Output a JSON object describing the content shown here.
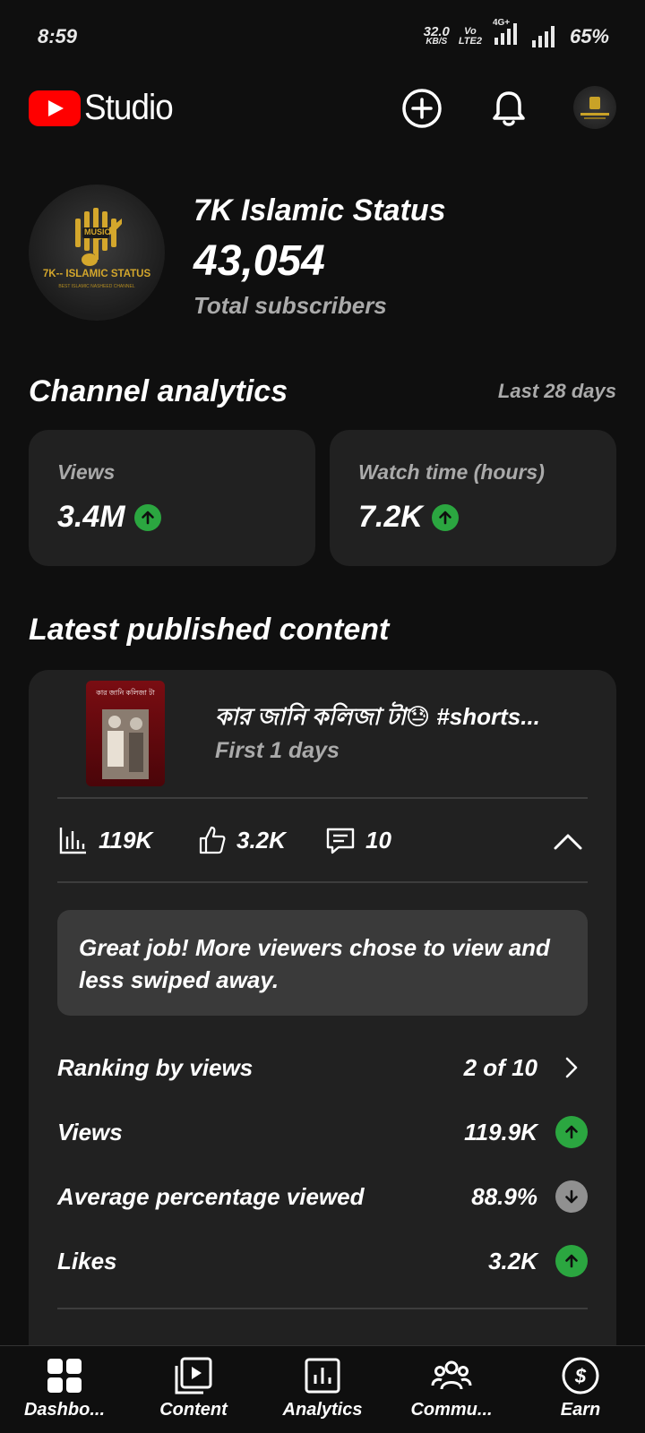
{
  "status_bar": {
    "time": "8:59",
    "net_speed": "32.0",
    "net_unit": "KB/S",
    "volte_top": "Vo",
    "volte_bottom": "LTE2",
    "network_type": "4G+",
    "battery": "65%"
  },
  "app_bar": {
    "logo_text": "Studio",
    "icons": [
      "create-icon",
      "notifications-icon",
      "account-avatar"
    ]
  },
  "channel": {
    "name": "7K Islamic Status",
    "subscribers": "43,054",
    "subscribers_label": "Total subscribers",
    "avatar_text": "7K-- ISLAMIC STATUS",
    "avatar_subtext": "BEST ISLAMIC NASHEED CHANNEL",
    "avatar_badge": "MUSIC"
  },
  "analytics": {
    "title": "Channel analytics",
    "period": "Last 28 days",
    "cards": [
      {
        "label": "Views",
        "value": "3.4M",
        "trend": "up"
      },
      {
        "label": "Watch time (hours)",
        "value": "7.2K",
        "trend": "up"
      }
    ]
  },
  "latest": {
    "title": "Latest published content",
    "video_title": "কার জানি কলিজা টা😓 #shorts...",
    "video_sub": "First 1 days",
    "thumb_text": "কার জানি কলিজা টা",
    "stats": {
      "views": "119K",
      "likes": "3.2K",
      "comments": "10"
    },
    "tip": "Great job! More viewers chose to view and less swiped away.",
    "rows": [
      {
        "label": "Ranking by views",
        "value": "2 of 10",
        "indicator": "chevron"
      },
      {
        "label": "Views",
        "value": "119.9K",
        "indicator": "up"
      },
      {
        "label": "Average percentage viewed",
        "value": "88.9%",
        "indicator": "down"
      },
      {
        "label": "Likes",
        "value": "3.2K",
        "indicator": "up"
      }
    ]
  },
  "nav": [
    {
      "label": "Dashbo...",
      "icon": "dashboard-icon"
    },
    {
      "label": "Content",
      "icon": "content-icon"
    },
    {
      "label": "Analytics",
      "icon": "analytics-icon"
    },
    {
      "label": "Commu...",
      "icon": "community-icon"
    },
    {
      "label": "Earn",
      "icon": "earn-icon"
    }
  ],
  "colors": {
    "background": "#0f0f0f",
    "card": "#212121",
    "secondary_text": "#aaaaaa",
    "up": "#2ba640",
    "down": "#909090",
    "brand": "#ff0000"
  }
}
